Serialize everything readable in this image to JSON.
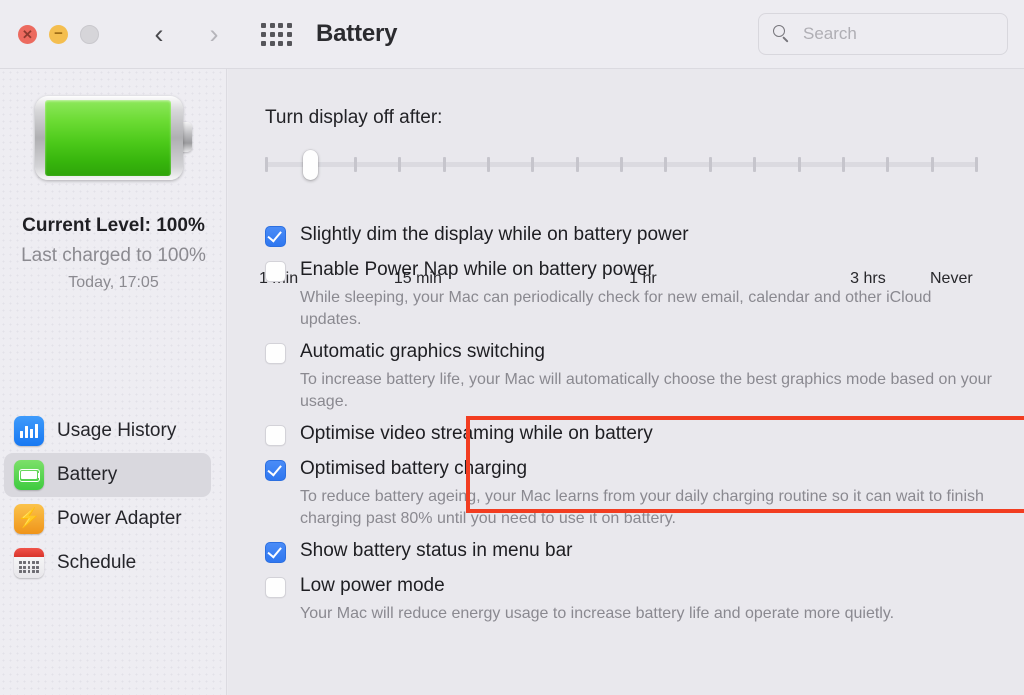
{
  "window": {
    "title": "Battery",
    "traffic_lights": [
      {
        "name": "close",
        "glyph": "✕",
        "color": "#EC6A5F"
      },
      {
        "name": "minimize",
        "glyph": "−",
        "color": "#F4BE4F"
      },
      {
        "name": "zoom",
        "glyph": "",
        "color": "#D6D5D9"
      }
    ],
    "nav": {
      "back": "‹",
      "forward": "›",
      "grid_icon": "show-all-icon"
    },
    "search": {
      "placeholder": "Search",
      "value": ""
    }
  },
  "sidebar": {
    "battery_level_line": "Current Level: 100%",
    "last_charged_line": "Last charged to 100%",
    "last_charged_time": "Today, 17:05",
    "items": [
      {
        "label": "Usage History",
        "icon": "usage-history-icon",
        "selected": false
      },
      {
        "label": "Battery",
        "icon": "battery-icon",
        "selected": true
      },
      {
        "label": "Power Adapter",
        "icon": "power-adapter-icon",
        "selected": false
      },
      {
        "label": "Schedule",
        "icon": "schedule-icon",
        "selected": false
      }
    ]
  },
  "main": {
    "slider": {
      "label": "Turn display off after:",
      "value_index": 1,
      "ticks": 17,
      "tick_labels": [
        {
          "text": "1 min",
          "pos_pct": 0
        },
        {
          "text": "15 min",
          "pos_pct": 22
        },
        {
          "text": "1 hr",
          "pos_pct": 55
        },
        {
          "text": "3 hrs",
          "pos_pct": 86
        },
        {
          "text": "Never",
          "pos_pct": 100
        }
      ]
    },
    "options": [
      {
        "title": "Slightly dim the display while on battery power",
        "checked": true,
        "description": ""
      },
      {
        "title": "Enable Power Nap while on battery power",
        "checked": false,
        "description": "While sleeping, your Mac can periodically check for new email, calendar and other iCloud updates."
      },
      {
        "title": "Automatic graphics switching",
        "checked": false,
        "description": "To increase battery life, your Mac will automatically choose the best graphics mode based on your usage.",
        "highlighted": true
      },
      {
        "title": "Optimise video streaming while on battery",
        "checked": false,
        "description": ""
      },
      {
        "title": "Optimised battery charging",
        "checked": true,
        "description": "To reduce battery ageing, your Mac learns from your daily charging routine so it can wait to finish charging past 80% until you need to use it on battery."
      },
      {
        "title": "Show battery status in menu bar",
        "checked": true,
        "description": ""
      },
      {
        "title": "Low power mode",
        "checked": false,
        "description": "Your Mac will reduce energy usage to increase battery life and operate more quietly."
      }
    ]
  },
  "colors": {
    "highlight_border": "#F23D21",
    "checkbox_on": "#3579F0",
    "battery_green": "#4CC91A",
    "window_bg": "#ECEBF0"
  }
}
